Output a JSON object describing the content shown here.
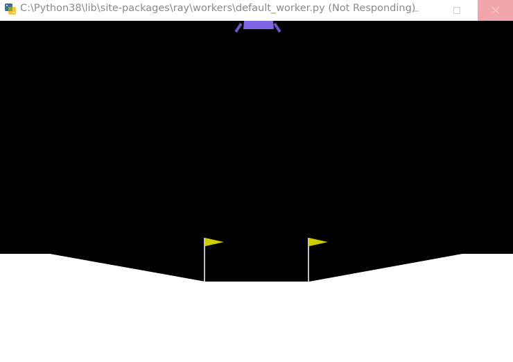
{
  "window": {
    "title": "C:\\Python38\\lib\\site-packages\\ray\\workers\\default_worker.py (Not Responding)",
    "icon": "python-icon",
    "controls": {
      "minimize_icon": "minimize-icon",
      "maximize_icon": "maximize-icon",
      "close_icon": "close-icon",
      "close_color": "#f1a6ac"
    }
  },
  "scene": {
    "environment": "lunar-lander",
    "colors": {
      "sky": "#000000",
      "terrain": "#fefefe",
      "flag": "#cccc00",
      "flagpole": "#ffffff",
      "lander": "#8066e6",
      "lander_legs": "#6b59c6"
    },
    "flags": [
      "left-flag",
      "right-flag"
    ]
  }
}
